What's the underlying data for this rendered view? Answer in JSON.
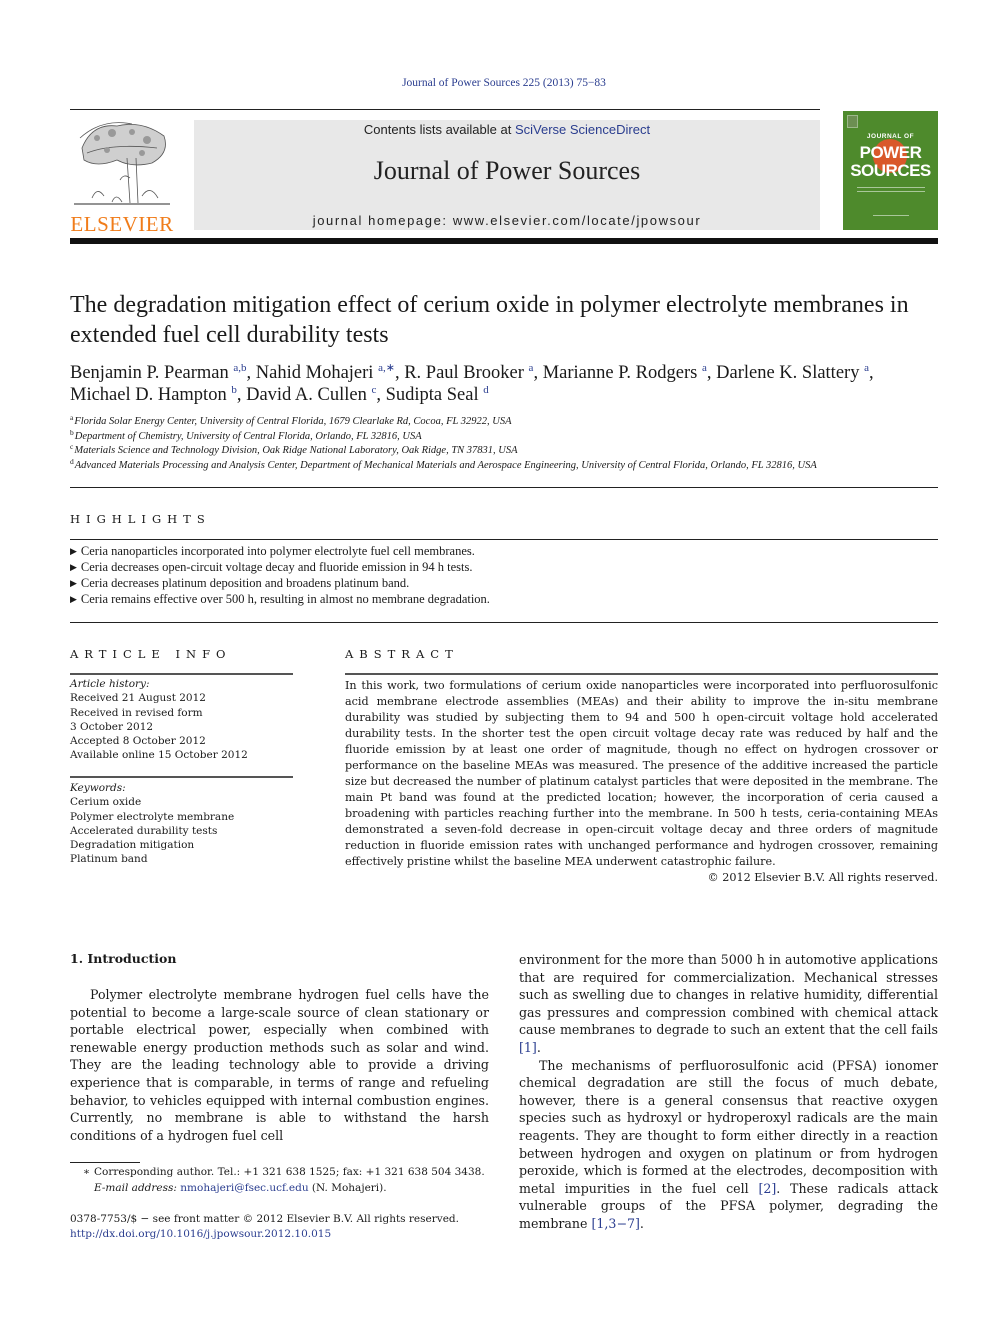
{
  "header": {
    "citation": "Journal of Power Sources 225 (2013) 75−83",
    "contents_prefix": "Contents lists available at ",
    "contents_link": "SciVerse ScienceDirect",
    "journal_title": "Journal of Power Sources",
    "homepage": "journal homepage: www.elsevier.com/locate/jpowsour",
    "publisher_wordmark": "ELSEVIER",
    "cover": {
      "line1": "JOURNAL OF",
      "line2": "POWER",
      "line3": "SOURCES",
      "background": "#4e8a2c",
      "sun_color": "#d9582a"
    }
  },
  "article": {
    "title": "The degradation mitigation effect of cerium oxide in polymer electrolyte membranes in extended fuel cell durability tests",
    "authors": [
      {
        "name": "Benjamin P. Pearman",
        "aff": "a,b",
        "sep": ", "
      },
      {
        "name": "Nahid Mohajeri",
        "aff": "a,∗",
        "sep": ", "
      },
      {
        "name": "R. Paul Brooker",
        "aff": "a",
        "sep": ", "
      },
      {
        "name": "Marianne P. Rodgers",
        "aff": "a",
        "sep": ", "
      },
      {
        "name": "Darlene K. Slattery",
        "aff": "a",
        "sep": ","
      },
      {
        "name": "Michael D. Hampton",
        "aff": "b",
        "sep": ", "
      },
      {
        "name": "David A. Cullen",
        "aff": "c",
        "sep": ", "
      },
      {
        "name": "Sudipta Seal",
        "aff": "d",
        "sep": ""
      }
    ],
    "affiliations": [
      {
        "key": "a",
        "text": "Florida Solar Energy Center, University of Central Florida, 1679 Clearlake Rd, Cocoa, FL 32922, USA"
      },
      {
        "key": "b",
        "text": "Department of Chemistry, University of Central Florida, Orlando, FL 32816, USA"
      },
      {
        "key": "c",
        "text": "Materials Science and Technology Division, Oak Ridge National Laboratory, Oak Ridge, TN 37831, USA"
      },
      {
        "key": "d",
        "text": "Advanced Materials Processing and Analysis Center, Department of Mechanical Materials and Aerospace Engineering, University of Central Florida, Orlando, FL 32816, USA"
      }
    ]
  },
  "highlights": {
    "heading": "HIGHLIGHTS",
    "bullet": "▶",
    "items": [
      "Ceria nanoparticles incorporated into polymer electrolyte fuel cell membranes.",
      "Ceria decreases open-circuit voltage decay and fluoride emission in 94 h tests.",
      "Ceria decreases platinum deposition and broadens platinum band.",
      "Ceria remains effective over 500 h, resulting in almost no membrane degradation."
    ]
  },
  "article_info": {
    "heading": "ARTICLE INFO",
    "history_label": "Article history:",
    "history": [
      "Received 21 August 2012",
      "Received in revised form",
      "3 October 2012",
      "Accepted 8 October 2012",
      "Available online 15 October 2012"
    ],
    "keywords_label": "Keywords:",
    "keywords": [
      "Cerium oxide",
      "Polymer electrolyte membrane",
      "Accelerated durability tests",
      "Degradation mitigation",
      "Platinum band"
    ]
  },
  "abstract": {
    "heading": "ABSTRACT",
    "text": "In this work, two formulations of cerium oxide nanoparticles were incorporated into perfluorosulfonic acid membrane electrode assemblies (MEAs) and their ability to improve the in-situ membrane durability was studied by subjecting them to 94 and 500 h open-circuit voltage hold accelerated durability tests. In the shorter test the open circuit voltage decay rate was reduced by half and the fluoride emission by at least one order of magnitude, though no effect on hydrogen crossover or performance on the baseline MEAs was measured. The presence of the additive increased the particle size but decreased the number of platinum catalyst particles that were deposited in the membrane. The main Pt band was found at the predicted location; however, the incorporation of ceria caused a broadening with particles reaching further into the membrane. In 500 h tests, ceria-containing MEAs demonstrated a seven-fold decrease in open-circuit voltage decay and three orders of magnitude reduction in fluoride emission rates with unchanged performance and hydrogen crossover, remaining effectively pristine whilst the baseline MEA underwent catastrophic failure.",
    "copyright": "© 2012 Elsevier B.V. All rights reserved."
  },
  "body": {
    "section_heading": "1.  Introduction",
    "left_paragraph": "Polymer electrolyte membrane hydrogen fuel cells have the potential to become a large-scale source of clean stationary or portable electrical power, especially when combined with renewable energy production methods such as solar and wind. They are the leading technology able to provide a driving experience that is comparable, in terms of range and refueling behavior, to vehicles equipped with internal combustion engines. Currently, no membrane is able to withstand the harsh conditions of a hydrogen fuel cell",
    "right_p1_text": "environment for the more than 5000 h in automotive applications that are required for commercialization. Mechanical stresses such as swelling due to changes in relative humidity, differential gas pressures and compression combined with chemical attack cause membranes to degrade to such an extent that the cell fails ",
    "right_p1_ref": "[1]",
    "right_p1_end": ".",
    "right_p2_text": "The mechanisms of perfluorosulfonic acid (PFSA) ionomer chemical degradation are still the focus of much debate, however, there is a general consensus that reactive oxygen species such as hydroxyl or hydroperoxyl radicals are the main reagents. They are thought to form either directly in a reaction between hydrogen and oxygen on platinum or from hydrogen peroxide, which is formed at the electrodes, decomposition with metal impurities in the fuel cell ",
    "right_p2_ref1": "[2]",
    "right_p2_mid": ". These radicals attack vulnerable groups of the PFSA polymer, degrading the membrane ",
    "right_p2_ref2": "[1,3−7]",
    "right_p2_end": "."
  },
  "footnotes": {
    "star": "∗",
    "corresponding": "Corresponding author. Tel.: +1 321 638 1525; fax: +1 321 638 504 3438.",
    "email_label": "E-mail address:",
    "email": "nmohajeri@fsec.ucf.edu",
    "email_suffix": " (N. Mohajeri).",
    "front_matter": "0378-7753/$ − see front matter © 2012 Elsevier B.V. All rights reserved.",
    "doi": "http://dx.doi.org/10.1016/j.jpowsour.2012.10.015"
  },
  "colors": {
    "link": "#2a3d8f",
    "elsevier_orange": "#f07c1a",
    "banner_bg": "#e8e8e8"
  }
}
